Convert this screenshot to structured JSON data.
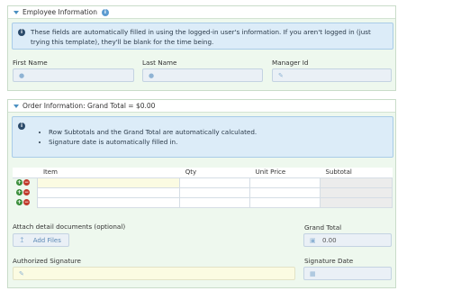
{
  "employee_section": {
    "title": "Employee Information",
    "info_text": "These fields are automatically filled in using the logged-in user's information. If you aren't logged in (just trying this template), they'll be blank for the time being.",
    "first_name_label": "First Name",
    "last_name_label": "Last Name",
    "manager_id_label": "Manager Id"
  },
  "order_section": {
    "title": "Order Information: Grand Total = $0.00",
    "info_bullets": [
      "Row Subtotals and the Grand Total are automatically calculated.",
      "Signature date is automatically filled in."
    ],
    "columns": [
      "Item",
      "Qty",
      "Unit Price",
      "Subtotal"
    ],
    "row_count": 3,
    "attach_label": "Attach detail documents (optional)",
    "add_files_label": "Add Files",
    "grand_total_label": "Grand Total",
    "grand_total_value": "0.00",
    "signature_label": "Authorized Signature",
    "signature_date_label": "Signature Date"
  },
  "icons": {
    "info": "info-icon",
    "user": "user-icon",
    "edit": "edit-icon",
    "upload": "upload-icon",
    "money": "money-icon",
    "pencil": "pencil-icon",
    "calendar": "calendar-icon",
    "add": "add-row-icon",
    "remove": "remove-row-icon"
  }
}
